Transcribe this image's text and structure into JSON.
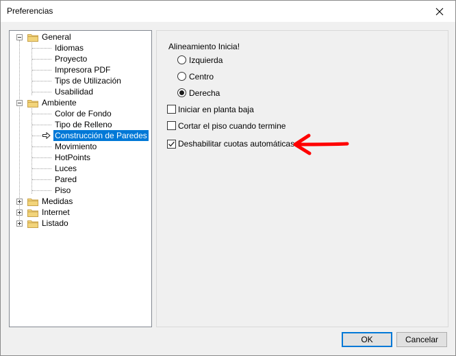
{
  "window": {
    "title": "Preferencias"
  },
  "tree": {
    "items": [
      {
        "label": "General"
      },
      {
        "label": "Idiomas"
      },
      {
        "label": "Proyecto"
      },
      {
        "label": "Impresora PDF"
      },
      {
        "label": "Tips de Utilización"
      },
      {
        "label": "Usabilidad"
      },
      {
        "label": "Ambiente"
      },
      {
        "label": "Color de Fondo"
      },
      {
        "label": "Tipo de Relleno"
      },
      {
        "label": "Construcción de Paredes"
      },
      {
        "label": "Movimiento"
      },
      {
        "label": "HotPoints"
      },
      {
        "label": "Luces"
      },
      {
        "label": "Pared"
      },
      {
        "label": "Piso"
      },
      {
        "label": "Medidas"
      },
      {
        "label": "Internet"
      },
      {
        "label": "Listado"
      }
    ]
  },
  "panel": {
    "group_title": "Alineamiento Inicia!",
    "radios": [
      {
        "label": "Izquierda",
        "checked": false
      },
      {
        "label": "Centro",
        "checked": false
      },
      {
        "label": "Derecha",
        "checked": true
      }
    ],
    "checkboxes": [
      {
        "label": "Iniciar en planta baja",
        "checked": false
      },
      {
        "label": "Cortar el piso cuando termine",
        "checked": false
      },
      {
        "label": "Deshabilitar cuotas automáticas",
        "checked": true
      }
    ]
  },
  "buttons": {
    "ok": "OK",
    "cancel": "Cancelar"
  },
  "colors": {
    "selection": "#0078d7",
    "annotation_arrow": "#ff0000",
    "folder": "#f2d47a"
  }
}
